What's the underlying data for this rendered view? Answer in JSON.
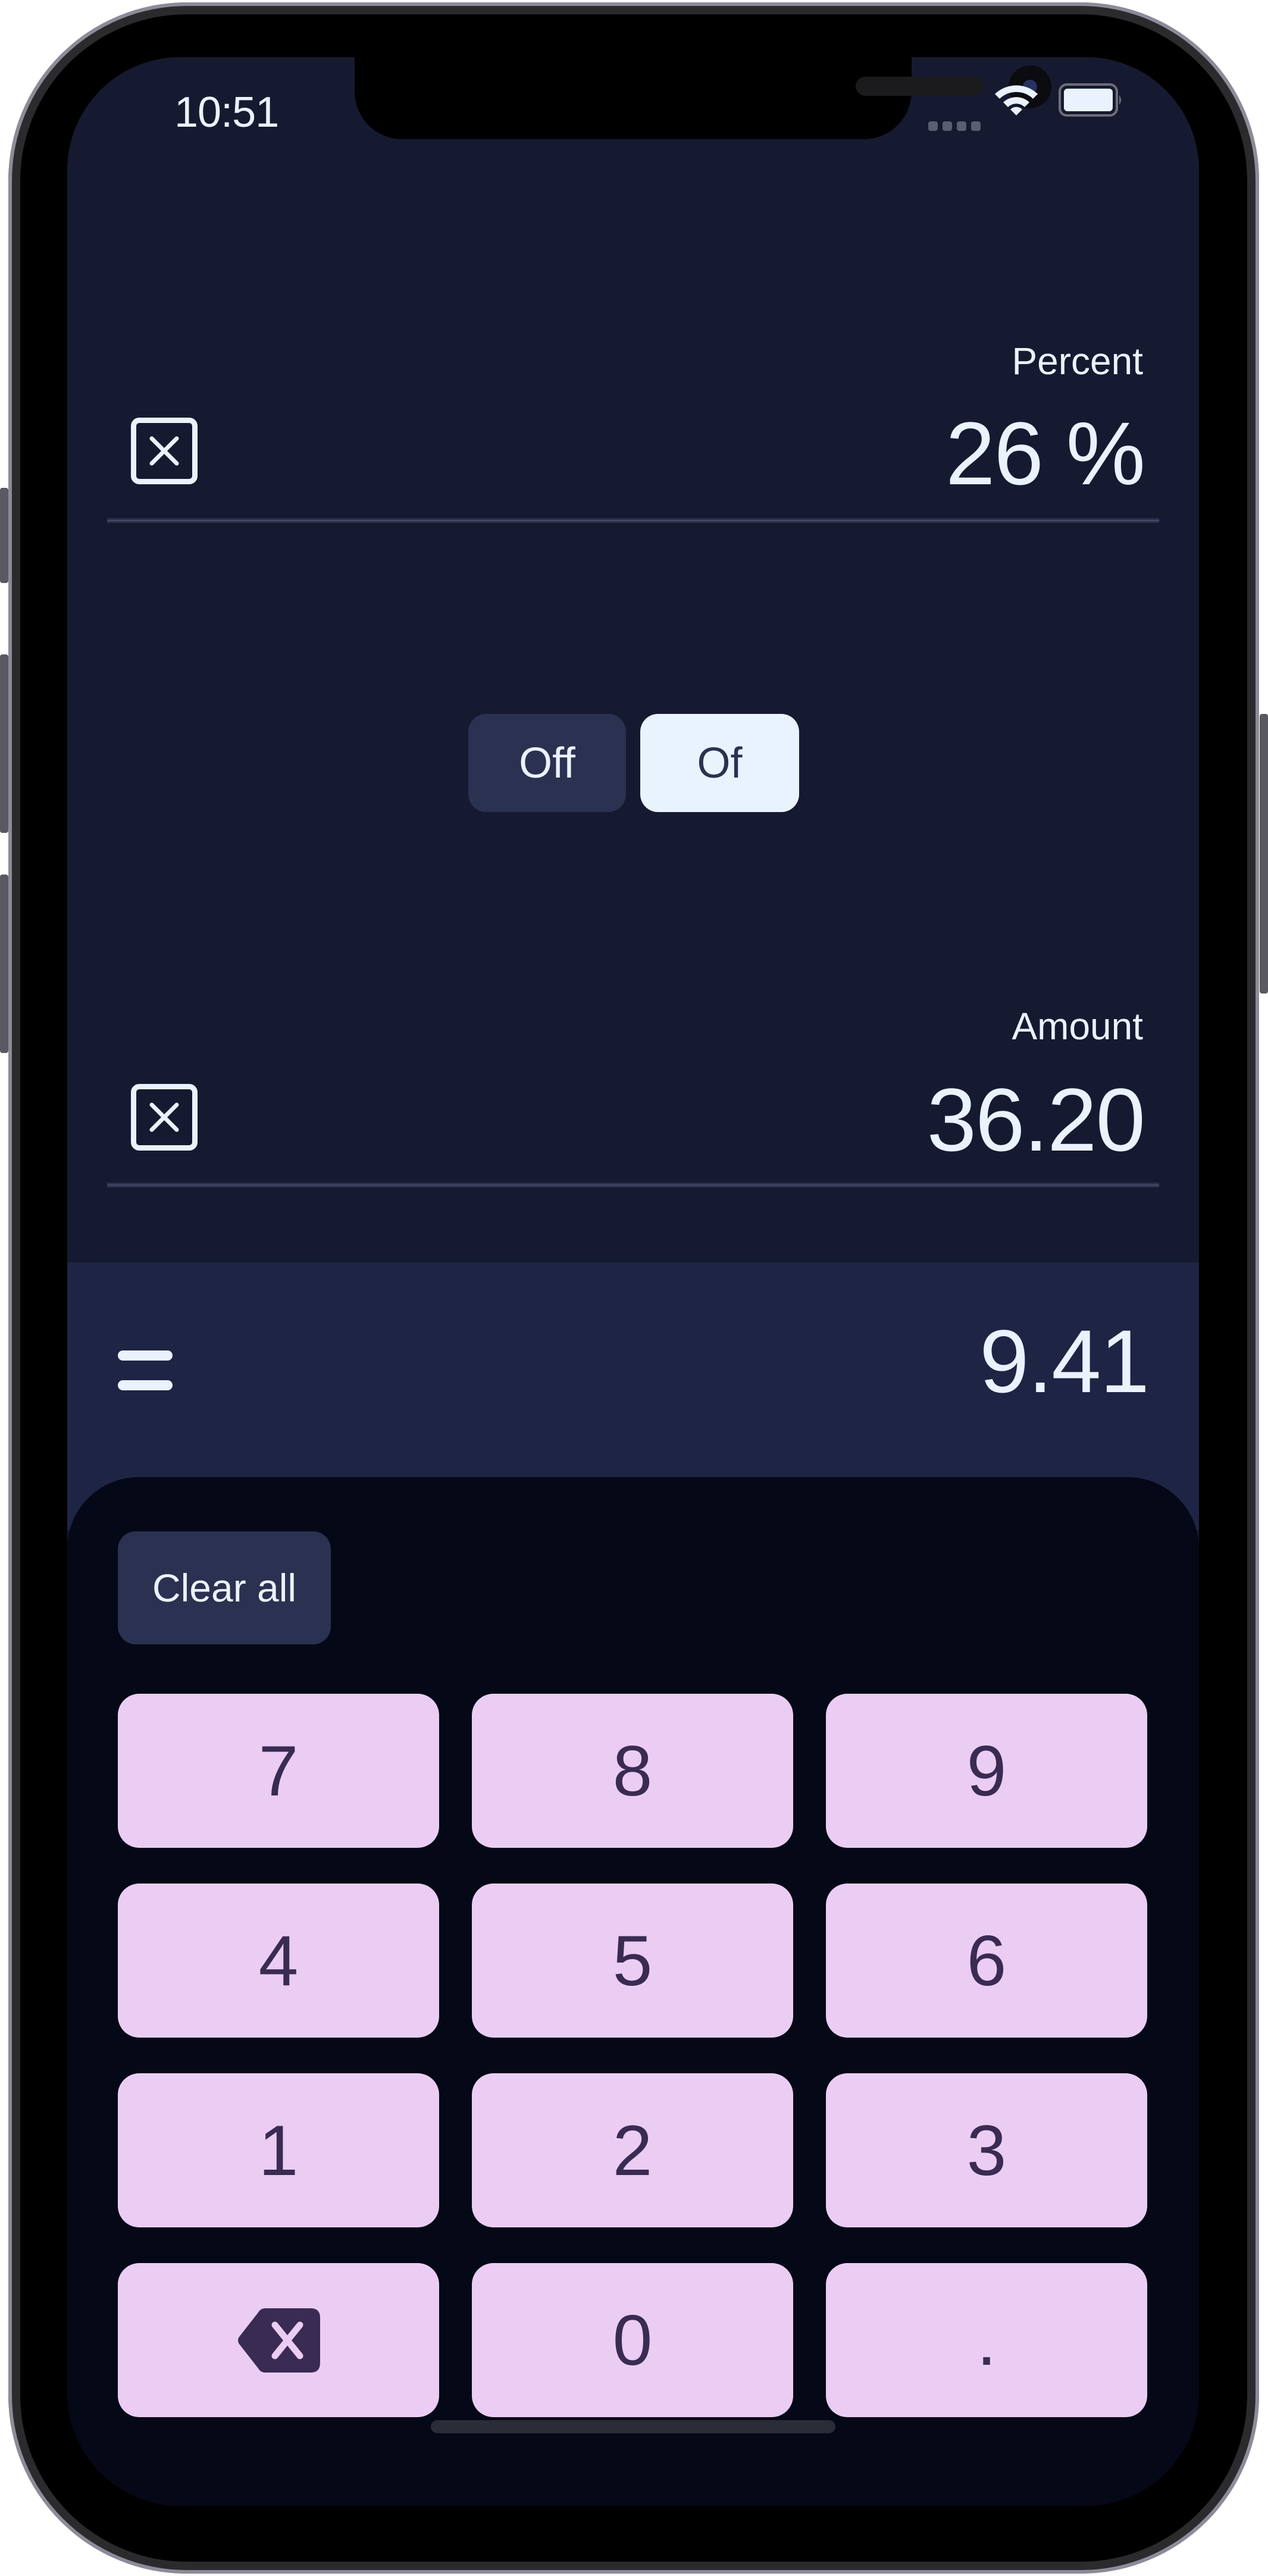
{
  "status_bar": {
    "time": "10:51",
    "icons": [
      "signal-dots-icon",
      "wifi-icon",
      "battery-icon"
    ]
  },
  "percent_field": {
    "label": "Percent",
    "value": "26 %",
    "clear_icon": "clear-box-x-icon"
  },
  "mode_toggle": {
    "options": [
      "Off",
      "Of"
    ],
    "selected": "Of"
  },
  "amount_field": {
    "label": "Amount",
    "value": "36.20",
    "clear_icon": "clear-box-x-icon"
  },
  "result": {
    "icon": "equals-icon",
    "value": "9.41"
  },
  "keypad": {
    "clear_all_label": "Clear all",
    "keys": [
      {
        "label": "7"
      },
      {
        "label": "8"
      },
      {
        "label": "9"
      },
      {
        "label": "4"
      },
      {
        "label": "5"
      },
      {
        "label": "6"
      },
      {
        "label": "1"
      },
      {
        "label": "2"
      },
      {
        "label": "3"
      },
      {
        "label": "",
        "icon": "backspace-icon"
      },
      {
        "label": "0"
      },
      {
        "label": "."
      }
    ]
  },
  "colors": {
    "background": "#161a30",
    "result_band": "#1e2444",
    "keypad_background": "#050816",
    "key_fill": "#ebcdf4",
    "key_text": "#3a2b52",
    "toggle_inactive": "#2b3150",
    "toggle_active": "#e9f3fe",
    "text": "#eaf2fd"
  }
}
